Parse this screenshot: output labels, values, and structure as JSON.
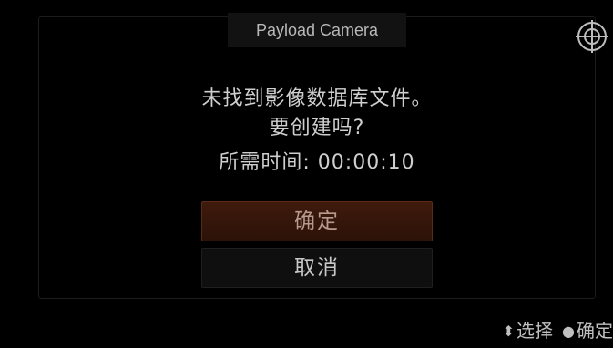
{
  "dialog": {
    "title": "Payload Camera",
    "message_line1": "未找到影像数据库文件。",
    "message_line2": "要创建吗?",
    "message_line3_label": "所需时间:",
    "message_line3_value": "00:00:10"
  },
  "buttons": {
    "ok_label": "确定",
    "cancel_label": "取消"
  },
  "footer": {
    "select_icon": "up-down-arrow-icon",
    "select_label": "选择",
    "confirm_icon": "filled-circle-icon",
    "confirm_label": "确定"
  },
  "colors": {
    "accent_button": "#3f1a0d",
    "background": "#000000",
    "text": "#cfcfcf"
  }
}
